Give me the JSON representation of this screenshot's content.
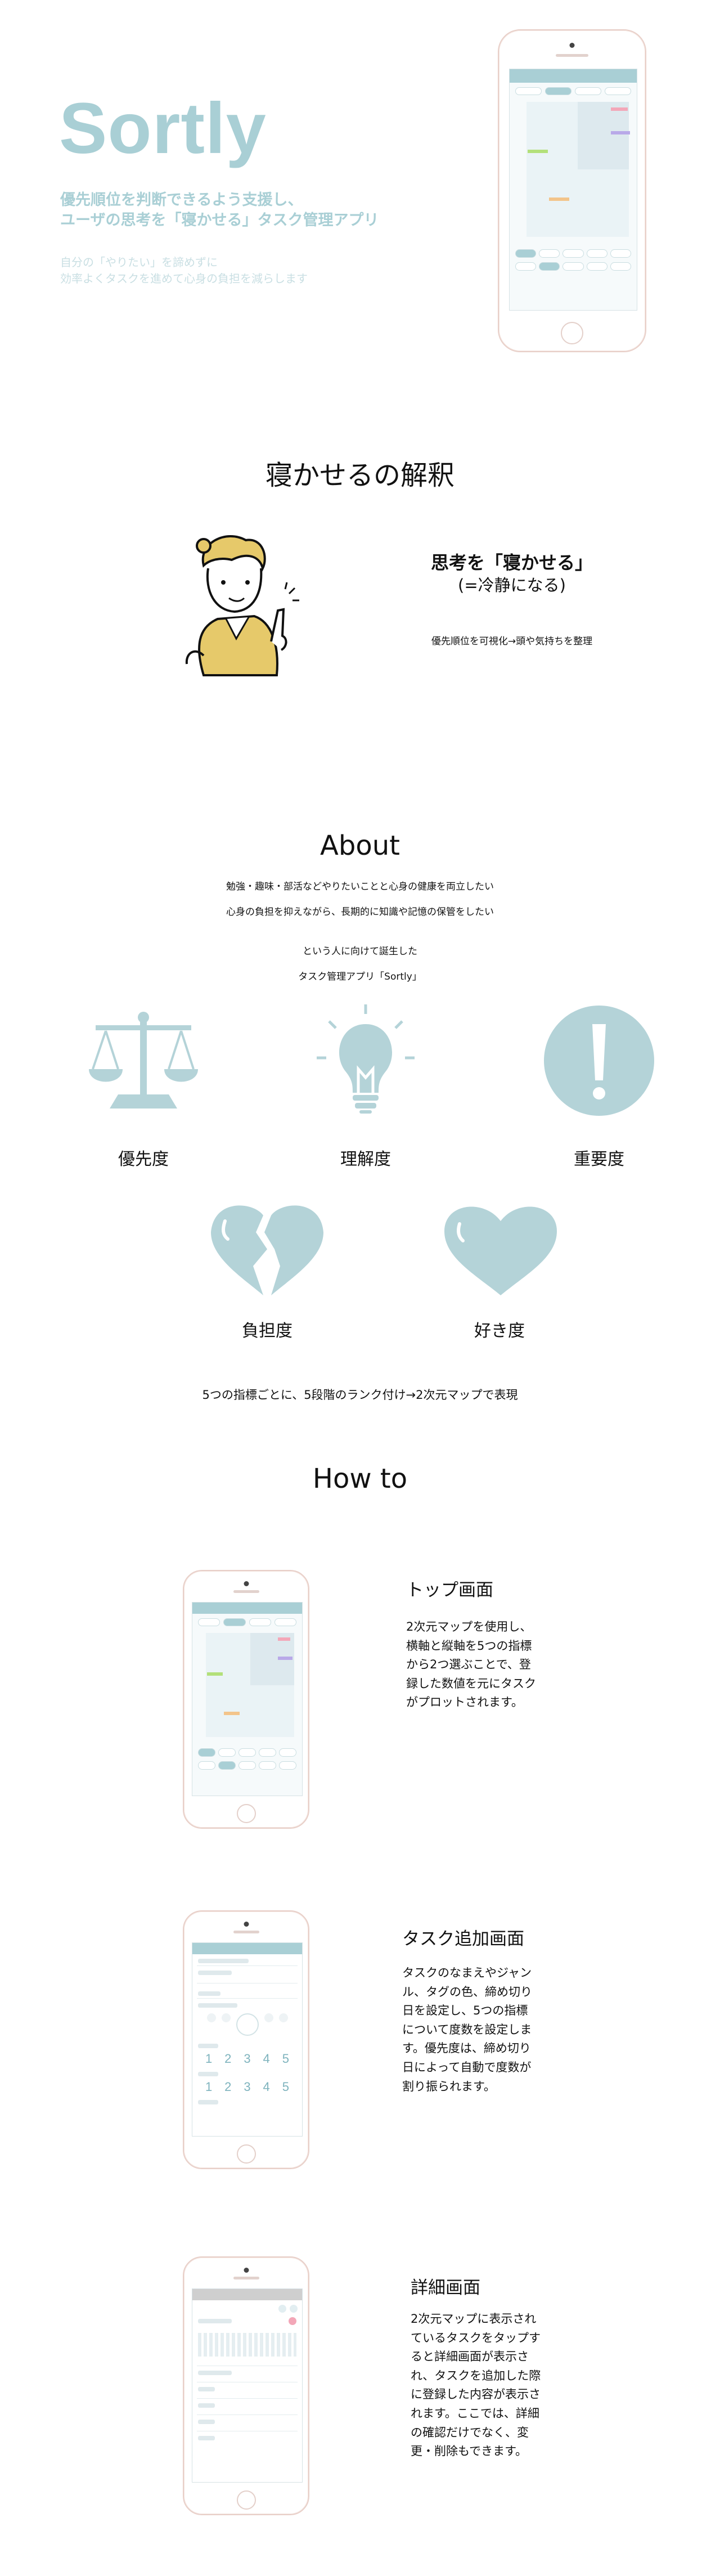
{
  "hero": {
    "title": "Sortly",
    "subtitle_line1": "優先順位を判断できるよう支援し、",
    "subtitle_line2": "ユーザの思考を「寝かせる」タスク管理アプリ",
    "desc_line1": "自分の「やりたい」を諦めずに",
    "desc_line2": "効率よくタスクを進めて心身の負担を減らします"
  },
  "interpretation": {
    "heading": "寝かせるの解釈",
    "title": "思考を「寝かせる」",
    "subtitle": "(=冷静になる)",
    "desc": "優先順位を可視化→頭や気持ちを整理"
  },
  "about": {
    "heading": "About",
    "line1": "勉強・趣味・部活などやりたいことと心身の健康を両立したい",
    "line2": "心身の負担を抑えながら、長期的に知識や記憶の保管をしたい",
    "line3": "という人に向けて誕生した",
    "line4": "タスク管理アプリ「Sortly」",
    "indicators": [
      "優先度",
      "理解度",
      "重要度",
      "負担度",
      "好き度"
    ],
    "summary": "5つの指標ごとに、5段階のランク付け→2次元マップで表現"
  },
  "howto": {
    "heading": "How to",
    "steps": [
      {
        "title": "トップ画面",
        "desc": "2次元マップを使用し、横軸と縦軸を5つの指標から2つ選ぶことで、登録した数値を元にタスクがプロットされます。"
      },
      {
        "title": "タスク追加画面",
        "desc": "タスクのなまえやジャンル、タグの色、締め切り日を設定し、5つの指標について度数を設定します。優先度は、締め切り日によって自動で度数が割り振られます。"
      },
      {
        "title": "詳細画面",
        "desc": "2次元マップに表示されているタスクをタップすると詳細画面が表示され、タスクを追加した際に登録した内容が表示されます。ここでは、詳細の確認だけでなく、変更・削除もできます。"
      }
    ],
    "form_numbers": [
      "1",
      "2",
      "3",
      "4",
      "5"
    ]
  },
  "colors": {
    "accent": "#a9cfd5",
    "accent_light": "#c9dfe3",
    "mustard": "#e6c96a"
  }
}
